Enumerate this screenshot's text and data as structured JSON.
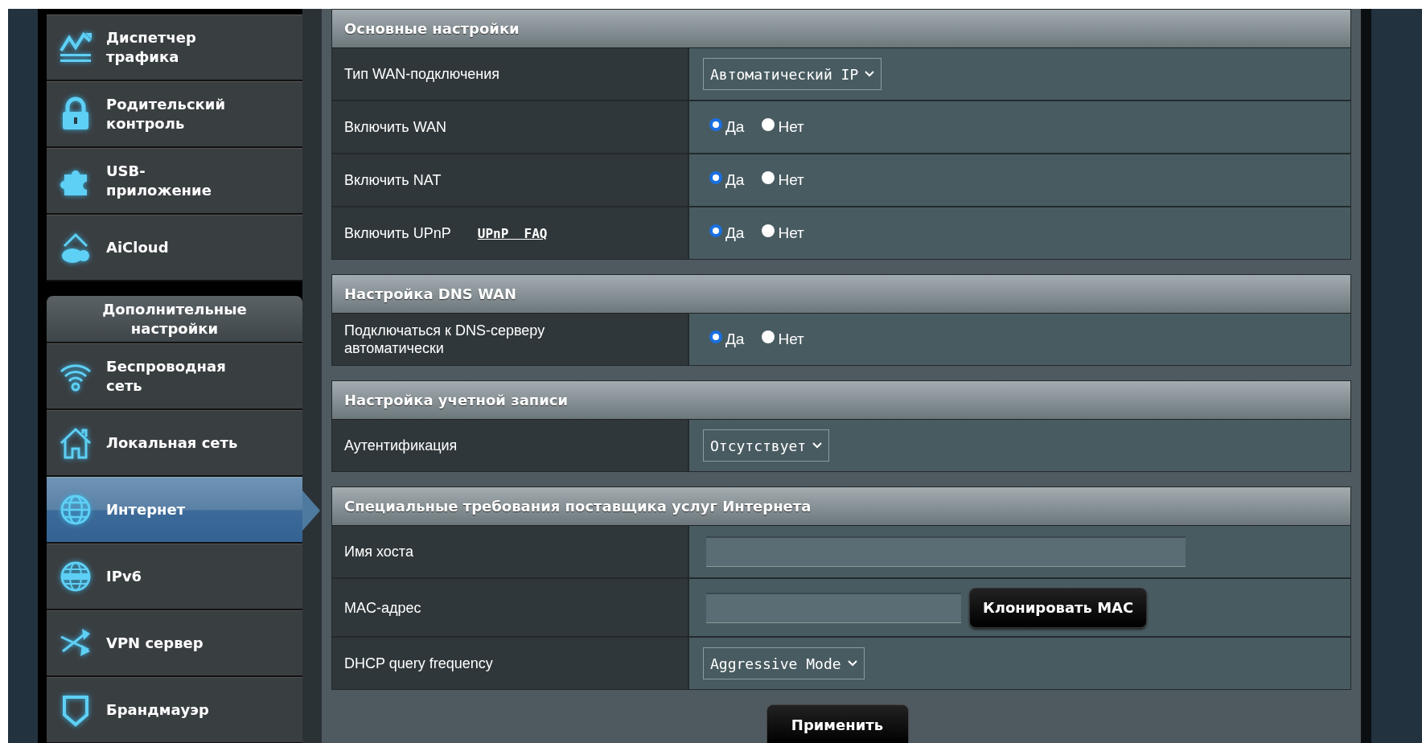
{
  "sidebar": {
    "items": [
      {
        "label": "Диспетчер трафика",
        "kind": "traffic",
        "selected": false
      },
      {
        "label": "Родительский контроль",
        "kind": "lock",
        "selected": false
      },
      {
        "label": "USB-приложение",
        "kind": "puzzle",
        "selected": false
      },
      {
        "label": "AiCloud",
        "kind": "cloud",
        "selected": false
      }
    ],
    "group_title": "Дополнительные настройки",
    "advanced_items": [
      {
        "label": "Беспроводная сеть",
        "kind": "wifi",
        "selected": false
      },
      {
        "label": "Локальная сеть",
        "kind": "house",
        "selected": false
      },
      {
        "label": "Интернет",
        "kind": "globe",
        "selected": true
      },
      {
        "label": "IPv6",
        "kind": "globe2",
        "selected": false
      },
      {
        "label": "VPN сервер",
        "kind": "vpn",
        "selected": false
      },
      {
        "label": "Брандмауэр",
        "kind": "shield",
        "selected": false
      }
    ]
  },
  "sections": [
    {
      "title": "Основные настройки",
      "rows": [
        {
          "kind": "select",
          "label": "Тип WAN-подключения",
          "value": "Автоматический IP"
        },
        {
          "kind": "radio",
          "label": "Включить WAN",
          "options": [
            {
              "label": "Да",
              "selected": true
            },
            {
              "label": "Нет",
              "selected": false
            }
          ]
        },
        {
          "kind": "radio",
          "label": "Включить NAT",
          "options": [
            {
              "label": "Да",
              "selected": true
            },
            {
              "label": "Нет",
              "selected": false
            }
          ]
        },
        {
          "kind": "radio",
          "label": "Включить UPnP",
          "link": "UPnP  FAQ",
          "options": [
            {
              "label": "Да",
              "selected": true
            },
            {
              "label": "Нет",
              "selected": false
            }
          ]
        }
      ]
    },
    {
      "title": "Настройка DNS WAN",
      "rows": [
        {
          "kind": "radio",
          "label": "Подключаться к DNS-серверу автоматически",
          "options": [
            {
              "label": "Да",
              "selected": true
            },
            {
              "label": "Нет",
              "selected": false
            }
          ]
        }
      ]
    },
    {
      "title": "Настройка учетной записи",
      "rows": [
        {
          "kind": "select",
          "label": "Аутентификация",
          "value": "Отсутствует"
        }
      ]
    },
    {
      "title": "Специальные требования поставщика услуг Интернета",
      "rows": [
        {
          "kind": "text",
          "label": "Имя хоста"
        },
        {
          "kind": "text",
          "label": "MAC-адрес",
          "button": "Клонировать MAC"
        },
        {
          "kind": "select",
          "label": "DHCP query frequency",
          "value": "Aggressive Mode"
        }
      ]
    }
  ],
  "apply_button": "Применить"
}
